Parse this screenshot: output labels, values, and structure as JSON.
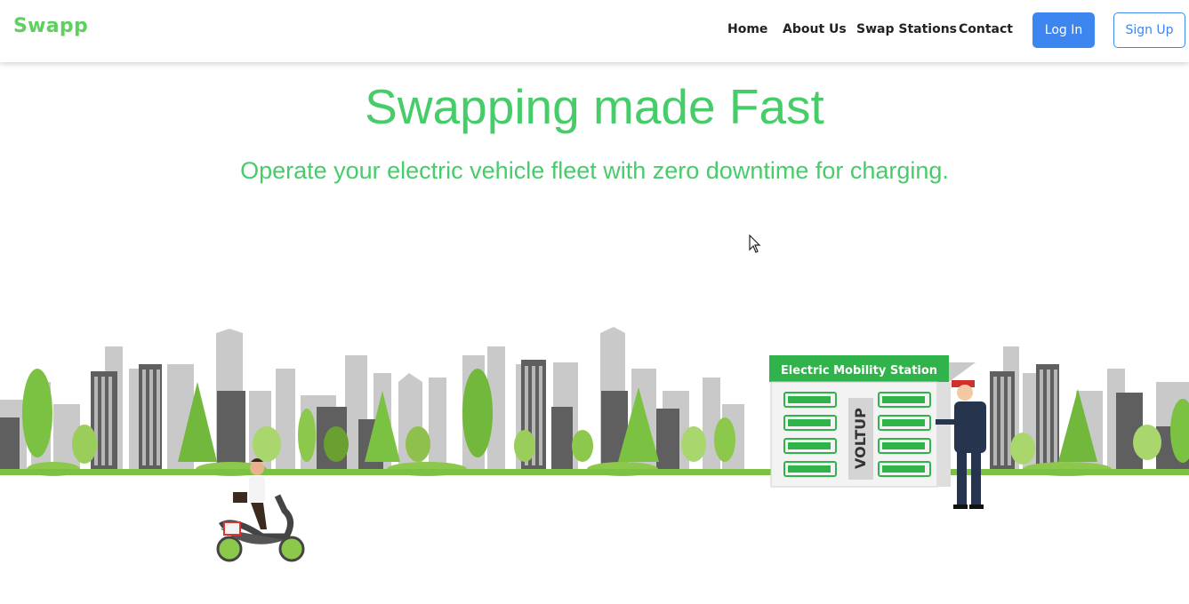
{
  "nav": {
    "brand": "Swapp",
    "links": [
      "Home",
      "About Us",
      "Swap Stations",
      "Contact"
    ],
    "login_label": "Log In",
    "signup_label": "Sign Up"
  },
  "hero": {
    "title": "Swapping made Fast",
    "subtitle": "Operate your electric vehicle fleet with zero downtime for charging."
  },
  "illustration": {
    "station_label": "Electric Mobility Station",
    "station_brand": "VOLTUP"
  },
  "colors": {
    "brand_green": "#47cc6a",
    "primary_blue": "#3d86f0",
    "skyline_gray": "#c8c8c8",
    "tree_green": "#7cc242",
    "ground_green": "#7cc242"
  }
}
